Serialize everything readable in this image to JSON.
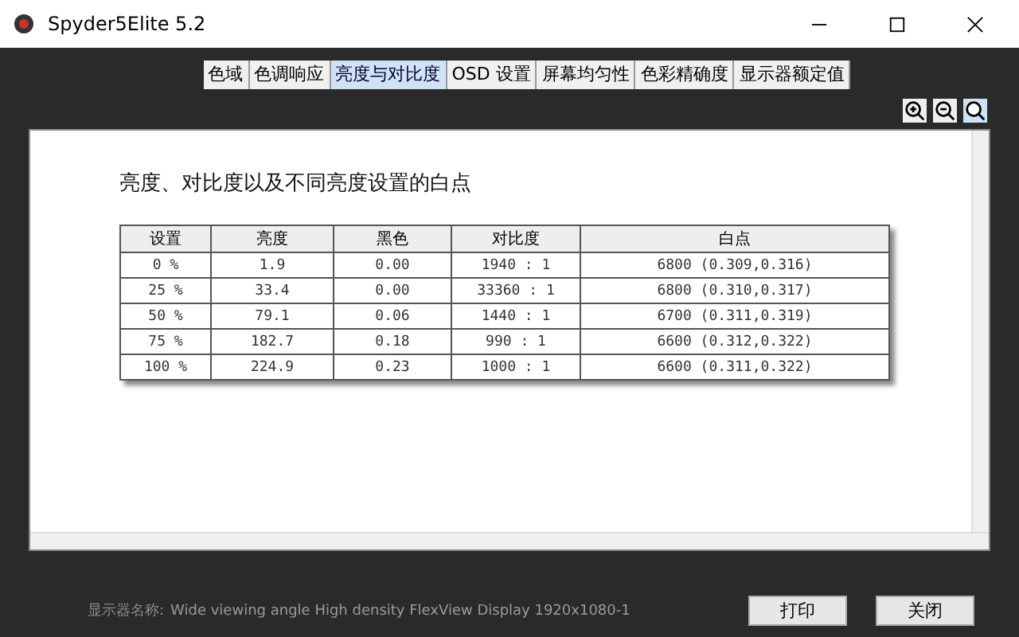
{
  "window": {
    "title": "Spyder5Elite 5.2"
  },
  "tabs": [
    {
      "label": "色域",
      "selected": false
    },
    {
      "label": "色调响应",
      "selected": false
    },
    {
      "label": "亮度与对比度",
      "selected": true
    },
    {
      "label": "OSD 设置",
      "selected": false
    },
    {
      "label": "屏幕均匀性",
      "selected": false
    },
    {
      "label": "色彩精确度",
      "selected": false
    },
    {
      "label": "显示器额定值",
      "selected": false
    }
  ],
  "report": {
    "heading": "亮度、对比度以及不同亮度设置的白点",
    "table": {
      "columns": [
        "设置",
        "亮度",
        "黑色",
        "对比度",
        "白点"
      ],
      "rows": [
        [
          "0 %",
          "1.9",
          "0.00",
          "1940 : 1",
          "6800 (0.309,0.316)"
        ],
        [
          "25 %",
          "33.4",
          "0.00",
          "33360 : 1",
          "6800 (0.310,0.317)"
        ],
        [
          "50 %",
          "79.1",
          "0.06",
          "1440 : 1",
          "6700 (0.311,0.319)"
        ],
        [
          "75 %",
          "182.7",
          "0.18",
          "990 : 1",
          "6600 (0.312,0.322)"
        ],
        [
          "100 %",
          "224.9",
          "0.23",
          "1000 : 1",
          "6600 (0.311,0.322)"
        ]
      ]
    }
  },
  "footer": {
    "label": "显示器名称:",
    "display_name": "Wide viewing angle  High density FlexView Display 1920x1080-1"
  },
  "buttons": [
    "打印",
    "关闭"
  ]
}
